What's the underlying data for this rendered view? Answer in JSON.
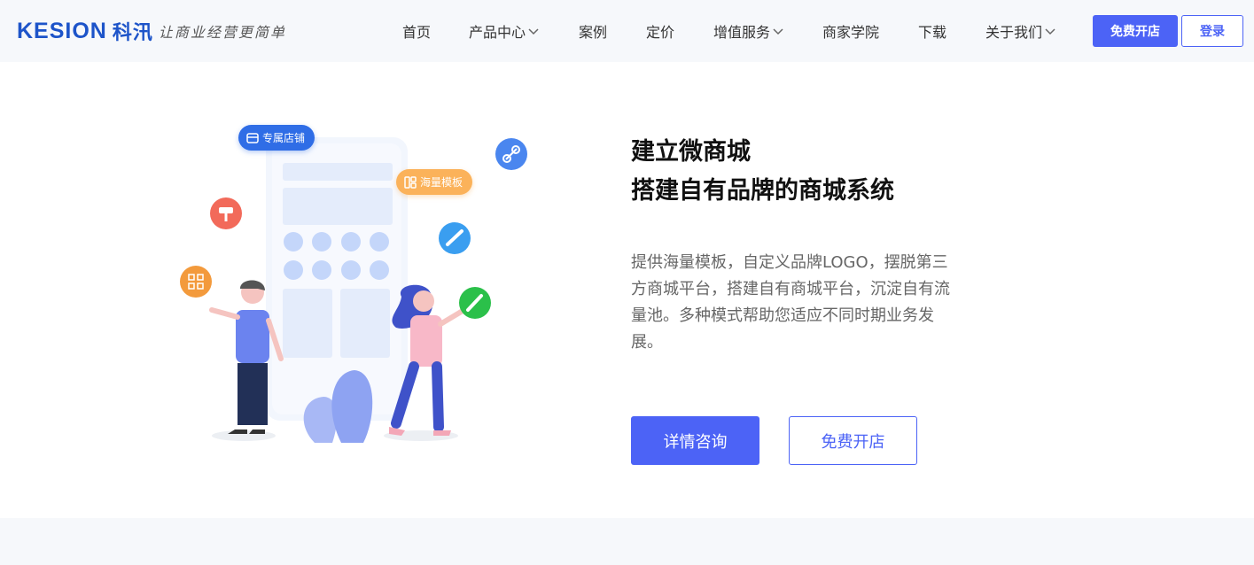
{
  "brand": {
    "logo_en": "KESION",
    "logo_cn": "科汛",
    "slogan": "让商业经营更简单"
  },
  "nav": {
    "items": [
      {
        "label": "首页",
        "has_dropdown": false
      },
      {
        "label": "产品中心",
        "has_dropdown": true
      },
      {
        "label": "案例",
        "has_dropdown": false
      },
      {
        "label": "定价",
        "has_dropdown": false
      },
      {
        "label": "增值服务",
        "has_dropdown": true
      },
      {
        "label": "商家学院",
        "has_dropdown": false
      },
      {
        "label": "下载",
        "has_dropdown": false
      },
      {
        "label": "关于我们",
        "has_dropdown": true
      }
    ],
    "free_open_label": "免费开店",
    "login_label": "登录"
  },
  "hero": {
    "title_line1": "建立微商城",
    "title_line2": "搭建自有品牌的商城系统",
    "description": "提供海量模板，自定义品牌LOGO，摆脱第三方商城平台，搭建自有商城平台，沉淀自有流量池。多种模式帮助您适应不同时期业务发展。",
    "consult_label": "详情咨询",
    "open_label": "免费开店",
    "tag_store": "专属店铺",
    "tag_templates": "海量模板"
  },
  "colors": {
    "accent": "#4c63f6",
    "brand": "#1d54c9"
  }
}
